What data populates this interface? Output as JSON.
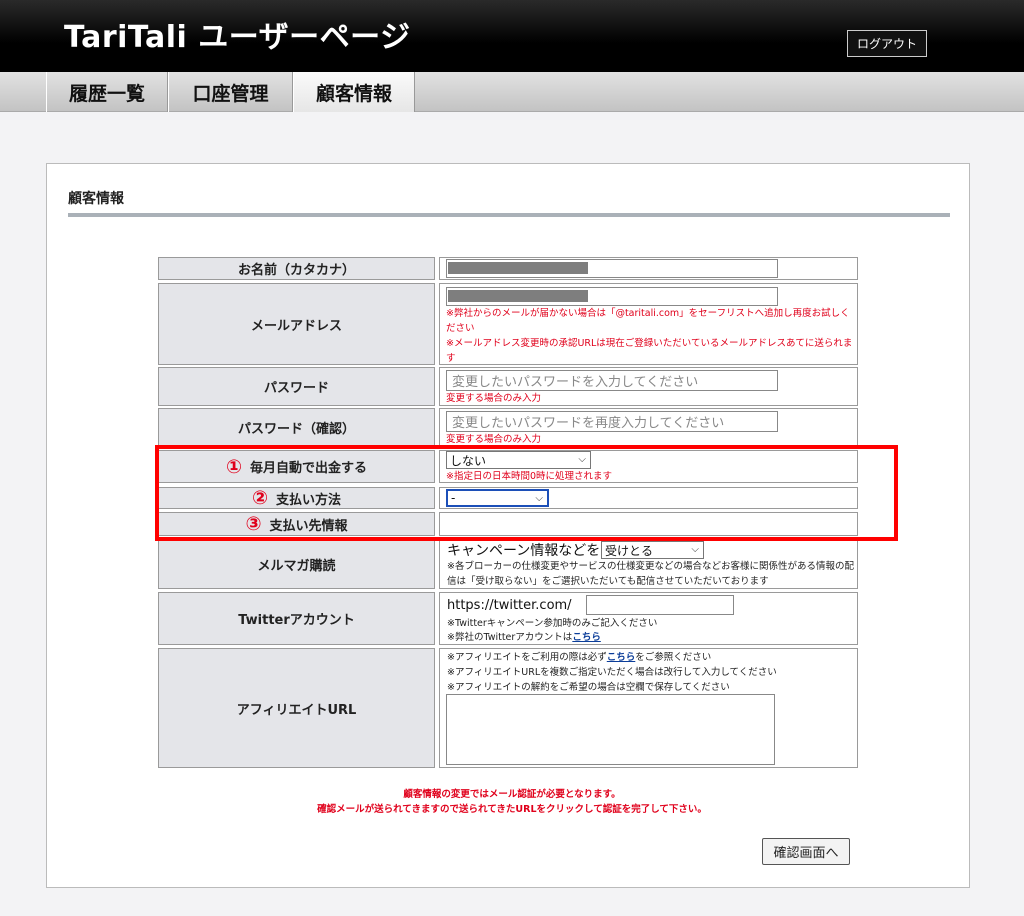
{
  "header": {
    "title": "TariTali ユーザーページ",
    "logout_label": "ログアウト"
  },
  "nav": {
    "tabs": [
      {
        "label": "履歴一覧"
      },
      {
        "label": "口座管理"
      },
      {
        "label": "顧客情報"
      }
    ]
  },
  "panel": {
    "title": "顧客情報"
  },
  "form": {
    "name_label": "お名前（カタカナ）",
    "email_label": "メールアドレス",
    "email_note1": "※弊社からのメールが届かない場合は「@taritali.com」をセーフリストへ追加し再度お試しください",
    "email_note2": "※メールアドレス変更時の承認URLは現在ご登録いただいているメールアドレスあてに送られます",
    "password_label": "パスワード",
    "password_placeholder": "変更したいパスワードを入力してください",
    "password_note": "変更する場合のみ入力",
    "password_confirm_label": "パスワード（確認）",
    "password_confirm_placeholder": "変更したいパスワードを再度入力してください",
    "password_confirm_note": "変更する場合のみ入力",
    "auto_withdraw_number": "①",
    "auto_withdraw_label": "毎月自動で出金する",
    "auto_withdraw_value": "しない",
    "auto_withdraw_note": "※指定日の日本時間0時に処理されます",
    "payment_method_number": "②",
    "payment_method_label": "支払い方法",
    "payment_method_value": "-",
    "payee_number": "③",
    "payee_label": "支払い先情報",
    "newsletter_label": "メルマガ購読",
    "newsletter_prefix": "キャンペーン情報などを",
    "newsletter_value": "受けとる",
    "newsletter_note": "※各ブローカーの仕様変更やサービスの仕様変更などの場合などお客様に関係性がある情報の配信は「受け取らない」をご選択いただいても配信させていただいております",
    "twitter_label": "Twitterアカウント",
    "twitter_prefix": "https://twitter.com/",
    "twitter_note1": "※Twitterキャンペーン参加時のみご記入ください",
    "twitter_note2_prefix": "※弊社のTwitterアカウントは",
    "twitter_note2_link": "こちら",
    "affiliate_label": "アフィリエイトURL",
    "affiliate_note1_prefix": "※アフィリエイトをご利用の際は必ず",
    "affiliate_note1_link": "こちら",
    "affiliate_note1_suffix": "をご参照ください",
    "affiliate_note2": "※アフィリエイトURLを複数ご指定いただく場合は改行して入力してください",
    "affiliate_note3": "※アフィリエイトの解約をご希望の場合は空欄で保存してください"
  },
  "footer": {
    "note1": "顧客情報の変更ではメール認証が必要となります。",
    "note2": "確認メールが送られてきますので送られてきたURLをクリックして認証を完了して下さい。",
    "confirm_label": "確認画面へ"
  }
}
